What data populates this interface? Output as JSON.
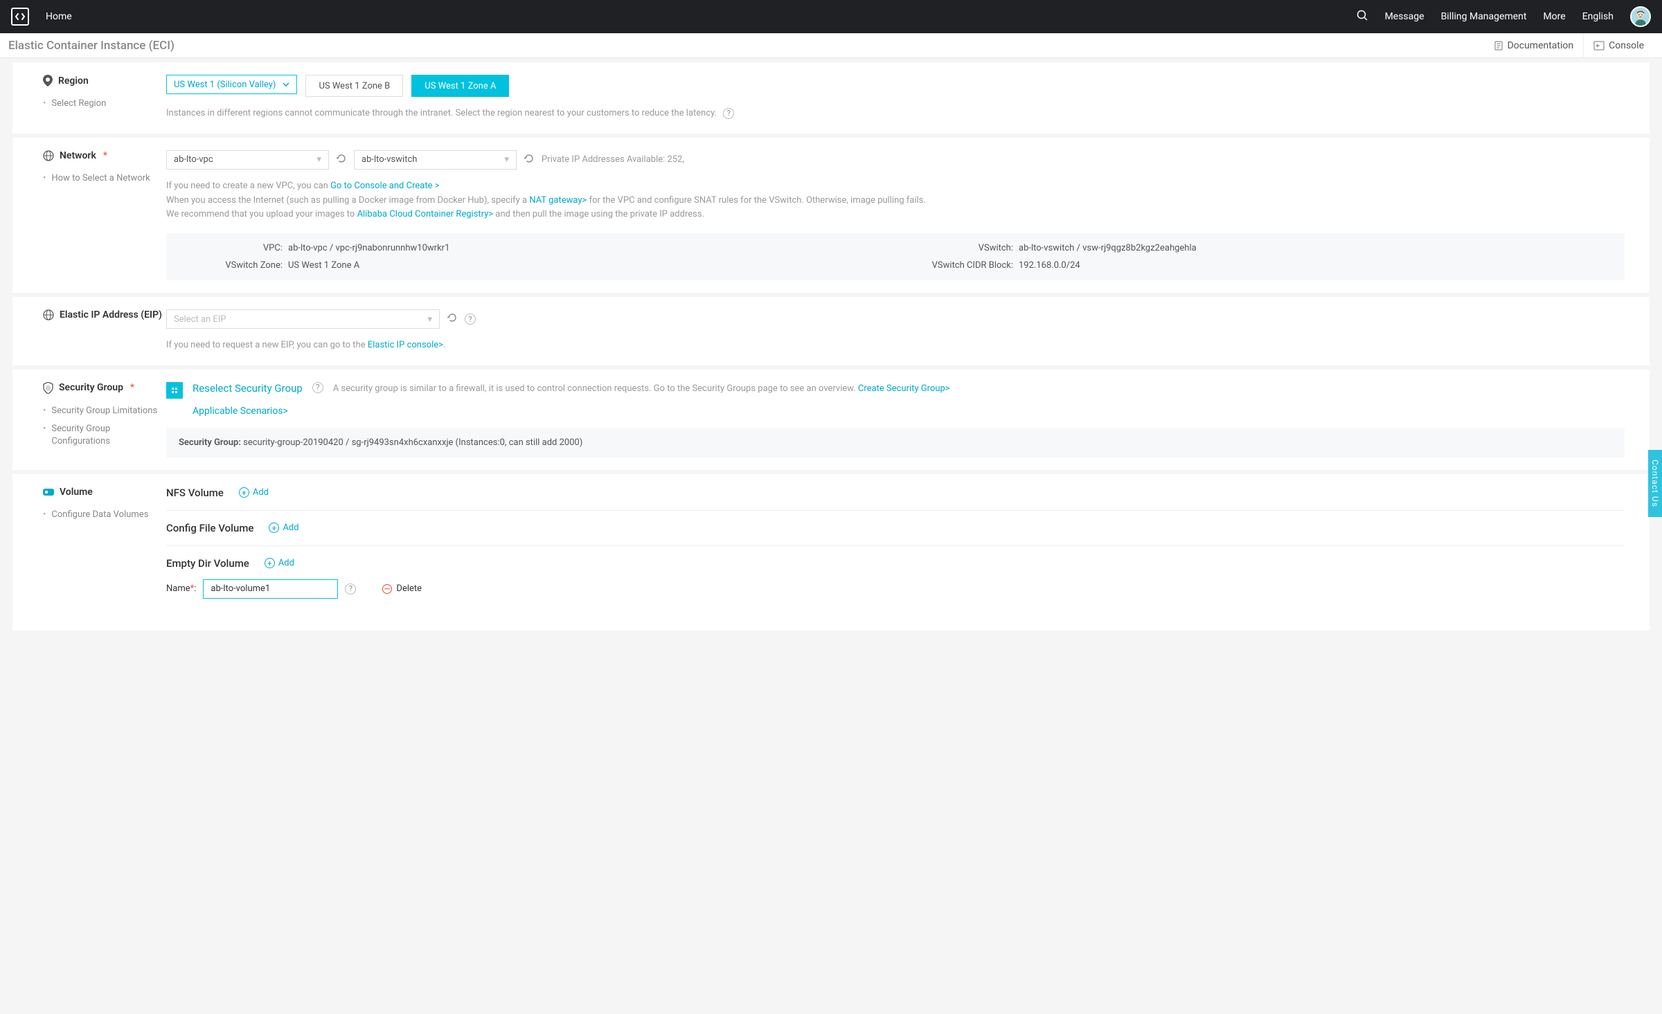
{
  "topnav": {
    "home": "Home",
    "message": "Message",
    "billing": "Billing Management",
    "more": "More",
    "lang": "English"
  },
  "subheader": {
    "title": "Elastic Container Instance (ECI)",
    "documentation": "Documentation",
    "console": "Console"
  },
  "region": {
    "title": "Region",
    "select_region": "Select Region",
    "selected": "US West 1 (Silicon Valley)",
    "zone_b": "US West 1 Zone B",
    "zone_a": "US West 1 Zone A",
    "hint": "Instances in different regions cannot communicate through the intranet. Select the region nearest to your customers to reduce the latency."
  },
  "network": {
    "title": "Network",
    "howto": "How to Select a Network",
    "vpc_sel": "ab-lto-vpc",
    "vswitch_sel": "ab-lto-vswitch",
    "avail": "Private IP Addresses Available: 252,",
    "line1a": "If you need to create a new VPC, you can ",
    "line1b": "Go to Console and Create >",
    "line2a": "When you access the Internet (such as pulling a Docker image from Docker Hub), specify a ",
    "line2b": "NAT gateway>",
    "line2c": " for the VPC and configure SNAT rules for the VSwitch. Otherwise, image pulling fails.",
    "line3a": "We recommend that you upload your images to ",
    "line3b": "Alibaba Cloud Container Registry>",
    "line3c": " and then pull the image using the private IP address.",
    "kv": {
      "vpc_l": "VPC:",
      "vpc_v": "ab-lto-vpc / vpc-rj9nabonrunnhw10wrkr1",
      "vswitch_l": "VSwitch:",
      "vswitch_v": "ab-lto-vswitch / vsw-rj9qgz8b2kgz2eahgehla",
      "zone_l": "VSwitch Zone:",
      "zone_v": "US West 1 Zone A",
      "cidr_l": "VSwitch CIDR Block:",
      "cidr_v": "192.168.0.0/24"
    }
  },
  "eip": {
    "title": "Elastic IP Address (EIP)",
    "placeholder": "Select an EIP",
    "hint1": "If you need to request a new EIP, you can go to the ",
    "hint2": "Elastic IP console>",
    "hint3": "."
  },
  "sg": {
    "title": "Security Group",
    "link1": "Security Group Limitations",
    "link2": "Security Group Configurations",
    "reselect": "Reselect Security Group",
    "note": "A security group is similar to a firewall, it is used to control connection requests. Go to the Security Groups page to see an overview. ",
    "create": "Create Security Group>",
    "scenarios": "Applicable Scenarios>",
    "info_l": "Security Group:",
    "info_v": "security-group-20190420 / sg-rj9493sn4xh6cxanxxje (Instances:0, can still add 2000)"
  },
  "volume": {
    "title": "Volume",
    "configure": "Configure Data Volumes",
    "nfs": "NFS Volume",
    "config": "Config File Volume",
    "empty": "Empty Dir Volume",
    "add": "Add",
    "name_l": "Name",
    "name_v": "ab-lto-volume1",
    "delete": "Delete"
  },
  "contact": "Contact Us"
}
